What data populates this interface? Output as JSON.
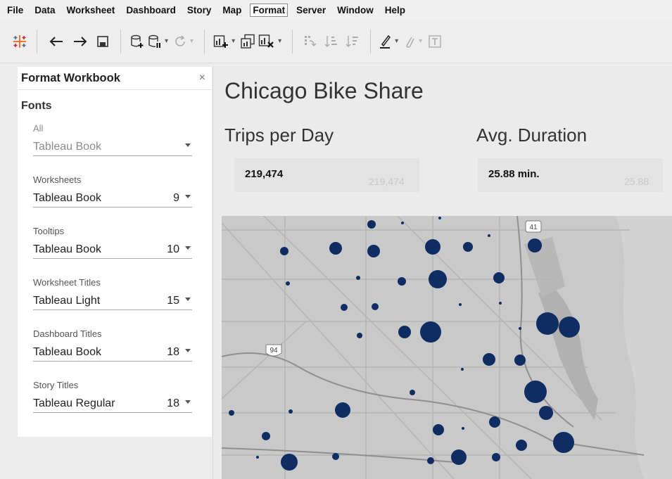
{
  "menu": [
    "File",
    "Data",
    "Worksheet",
    "Dashboard",
    "Story",
    "Map",
    "Format",
    "Server",
    "Window",
    "Help"
  ],
  "menu_active": "Format",
  "pane": {
    "title": "Format Workbook",
    "close": "×",
    "section": "Fonts",
    "fonts": [
      {
        "label": "All",
        "font": "Tableau Book",
        "size": ""
      },
      {
        "label": "Worksheets",
        "font": "Tableau Book",
        "size": "9"
      },
      {
        "label": "Tooltips",
        "font": "Tableau Book",
        "size": "10"
      },
      {
        "label": "Worksheet Titles",
        "font": "Tableau Light",
        "size": "15"
      },
      {
        "label": "Dashboard Titles",
        "font": "Tableau Book",
        "size": "18"
      },
      {
        "label": "Story Titles",
        "font": "Tableau Regular",
        "size": "18"
      }
    ]
  },
  "dashboard": {
    "title": "Chicago Bike Share",
    "kpis": [
      {
        "title": "Trips per Day",
        "value": "219,474",
        "ghost": "219,474"
      },
      {
        "title": "Avg. Duration",
        "value": "25.88 min.",
        "ghost": "25.88"
      }
    ],
    "map": {
      "highway_shields": [
        "41",
        "94"
      ],
      "station_color": "#0f2d63",
      "park_color": "#a9a9a9",
      "water_color": "#d2d2d2"
    }
  },
  "toolbar": {
    "icons": [
      "tableau-logo-icon",
      "undo-icon",
      "redo-icon",
      "save-icon",
      "new-data-source-icon",
      "pause-updates-icon",
      "refresh-icon",
      "new-worksheet-icon",
      "duplicate-sheet-icon",
      "clear-sheet-icon",
      "swap-rows-columns-icon",
      "sort-ascending-icon",
      "sort-descending-icon",
      "highlight-icon",
      "group-members-icon",
      "show-labels-icon"
    ]
  }
}
